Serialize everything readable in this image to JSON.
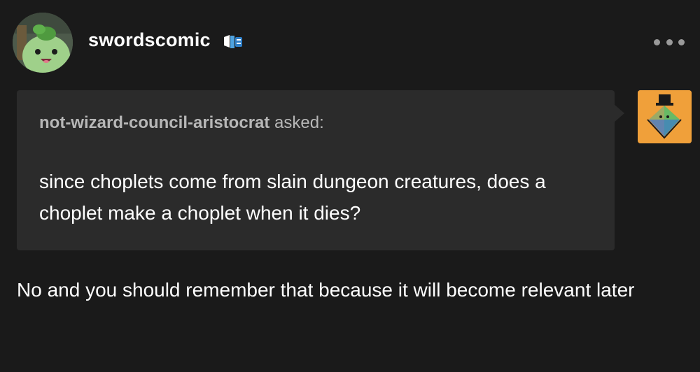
{
  "post": {
    "blog_name": "swordscomic",
    "icons": {
      "avatar": "blog-avatar",
      "badge": "badge-icon",
      "more": "more-options-icon"
    }
  },
  "ask": {
    "asker_name": "not-wizard-council-aristocrat",
    "asked_label": "asked:",
    "question": "since choplets come from slain dungeon creatures, does a choplet make a choplet when it dies?",
    "asker_avatar_icon": "asker-avatar"
  },
  "answer": {
    "text": "No and you should remember that because it will become relevant later"
  },
  "colors": {
    "background": "#1a1a1a",
    "bubble": "#2b2b2b",
    "asker_avatar_bg": "#f0a03a"
  }
}
